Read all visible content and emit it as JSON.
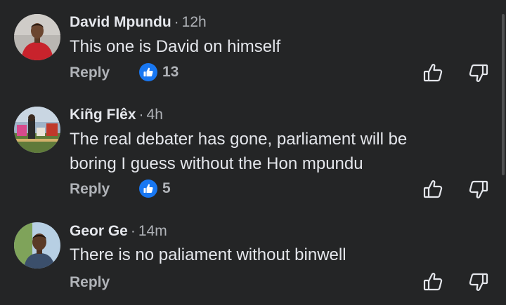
{
  "comments": [
    {
      "author": "David Mpundu",
      "separator": "·",
      "time": "12h",
      "text": "This one is David on himself",
      "reply_label": "Reply",
      "reaction_count": "13"
    },
    {
      "author": "Kiñg Flêx",
      "separator": "·",
      "time": "4h",
      "text": "The real debater has gone, parliament will be\nboring I guess without the Hon mpundu",
      "reply_label": "Reply",
      "reaction_count": "5"
    },
    {
      "author": "Geor Ge",
      "separator": "·",
      "time": "14m",
      "text": "There is no paliament without binwell",
      "reply_label": "Reply"
    }
  ],
  "icons": {
    "reaction": "like-icon",
    "upvote": "thumbs-up-outline-icon",
    "downvote": "thumbs-down-outline-icon"
  },
  "colors": {
    "background": "#242526",
    "primary_text": "#e4e6eb",
    "secondary_text": "#b0b3b8",
    "like_blue": "#1877f2"
  }
}
